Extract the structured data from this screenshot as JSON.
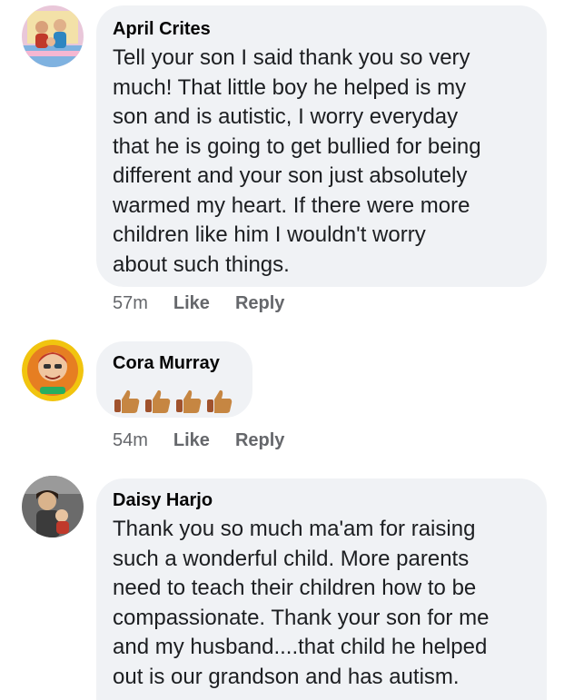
{
  "comments": [
    {
      "author": "April Crites",
      "text": "Tell your son I said thank you so very\nmuch! That little boy he helped is my\nson and is autistic, I worry everyday\nthat he is going to get bullied for being\ndifferent and your son just absolutely\nwarmed my heart. If there were more\nchildren like him I wouldn't worry\nabout such things.",
      "time": "57m",
      "like_label": "Like",
      "reply_label": "Reply",
      "avatar_icon": "family-photo-avatar"
    },
    {
      "author": "Cora Murray",
      "reaction": "thumbs-up-icon x4",
      "time": "54m",
      "like_label": "Like",
      "reply_label": "Reply",
      "avatar_icon": "person-portrait-avatar"
    },
    {
      "author": "Daisy Harjo",
      "text": "Thank you so much ma'am for raising\nsuch a wonderful child. More parents\nneed to teach their children how to be\ncompassionate. Thank your son for me\nand my husband....that child he helped\nout is our grandson and has autism.",
      "avatar_icon": "person-holding-child-avatar"
    }
  ],
  "colors": {
    "bubble": "#f0f2f5",
    "meta_text": "#65676b",
    "thumb_skin": "#c68642"
  }
}
